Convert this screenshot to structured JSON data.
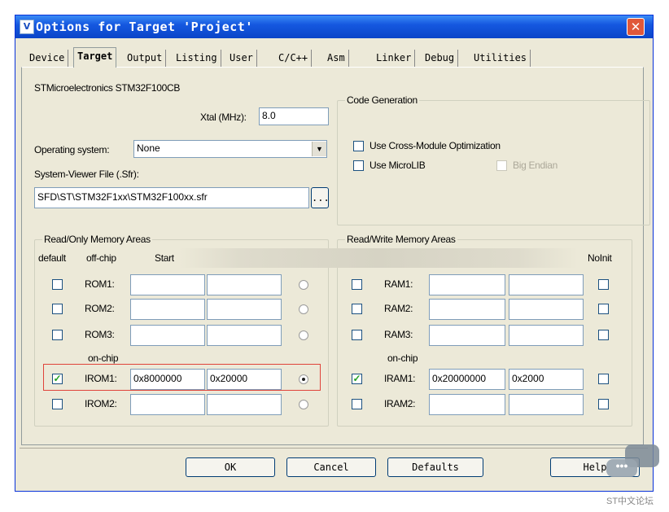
{
  "window": {
    "title": "Options for Target 'Project'"
  },
  "tabs": [
    "Device",
    "Target",
    "Output",
    "Listing",
    "User",
    "C/C++",
    "Asm",
    "Linker",
    "Debug",
    "Utilities"
  ],
  "active_tab": "Target",
  "device_name": "STMicroelectronics STM32F100CB",
  "xtal": {
    "label": "Xtal (MHz):",
    "value": "8.0"
  },
  "os": {
    "label": "Operating system:",
    "value": "None"
  },
  "sfr": {
    "label": "System-Viewer File (.Sfr):",
    "value": "SFD\\ST\\STM32F1xx\\STM32F100xx.sfr",
    "browse": "..."
  },
  "codegen": {
    "title": "Code Generation",
    "cross_module": "Use Cross-Module Optimization",
    "microlib": "Use MicroLIB",
    "big_endian": "Big Endian"
  },
  "ro_memory": {
    "title": "Read/Only Memory Areas",
    "col_default": "default",
    "col_offchip": "off-chip",
    "col_start": "Start",
    "onchip_label": "on-chip",
    "rows": [
      {
        "name": "ROM1:",
        "default": false,
        "start": "",
        "size": "",
        "startup": false
      },
      {
        "name": "ROM2:",
        "default": false,
        "start": "",
        "size": "",
        "startup": false
      },
      {
        "name": "ROM3:",
        "default": false,
        "start": "",
        "size": "",
        "startup": false
      },
      {
        "name": "IROM1:",
        "default": true,
        "start": "0x8000000",
        "size": "0x20000",
        "startup": true
      },
      {
        "name": "IROM2:",
        "default": false,
        "start": "",
        "size": "",
        "startup": false
      }
    ]
  },
  "rw_memory": {
    "title": "Read/Write Memory Areas",
    "col_noinit": "NoInit",
    "onchip_label": "on-chip",
    "rows": [
      {
        "name": "RAM1:",
        "default": false,
        "start": "",
        "size": "",
        "noinit": false
      },
      {
        "name": "RAM2:",
        "default": false,
        "start": "",
        "size": "",
        "noinit": false
      },
      {
        "name": "RAM3:",
        "default": false,
        "start": "",
        "size": "",
        "noinit": false
      },
      {
        "name": "IRAM1:",
        "default": true,
        "start": "0x20000000",
        "size": "0x2000",
        "noinit": false
      },
      {
        "name": "IRAM2:",
        "default": false,
        "start": "",
        "size": "",
        "noinit": false
      }
    ]
  },
  "buttons": {
    "ok": "OK",
    "cancel": "Cancel",
    "defaults": "Defaults",
    "help": "Help"
  },
  "watermark": "ST中文论坛",
  "colors": {
    "title_bar": "#0a44c8",
    "dialog_bg": "#ece9d8",
    "highlight_box": "#e0433a",
    "check_mark": "#21a121"
  }
}
